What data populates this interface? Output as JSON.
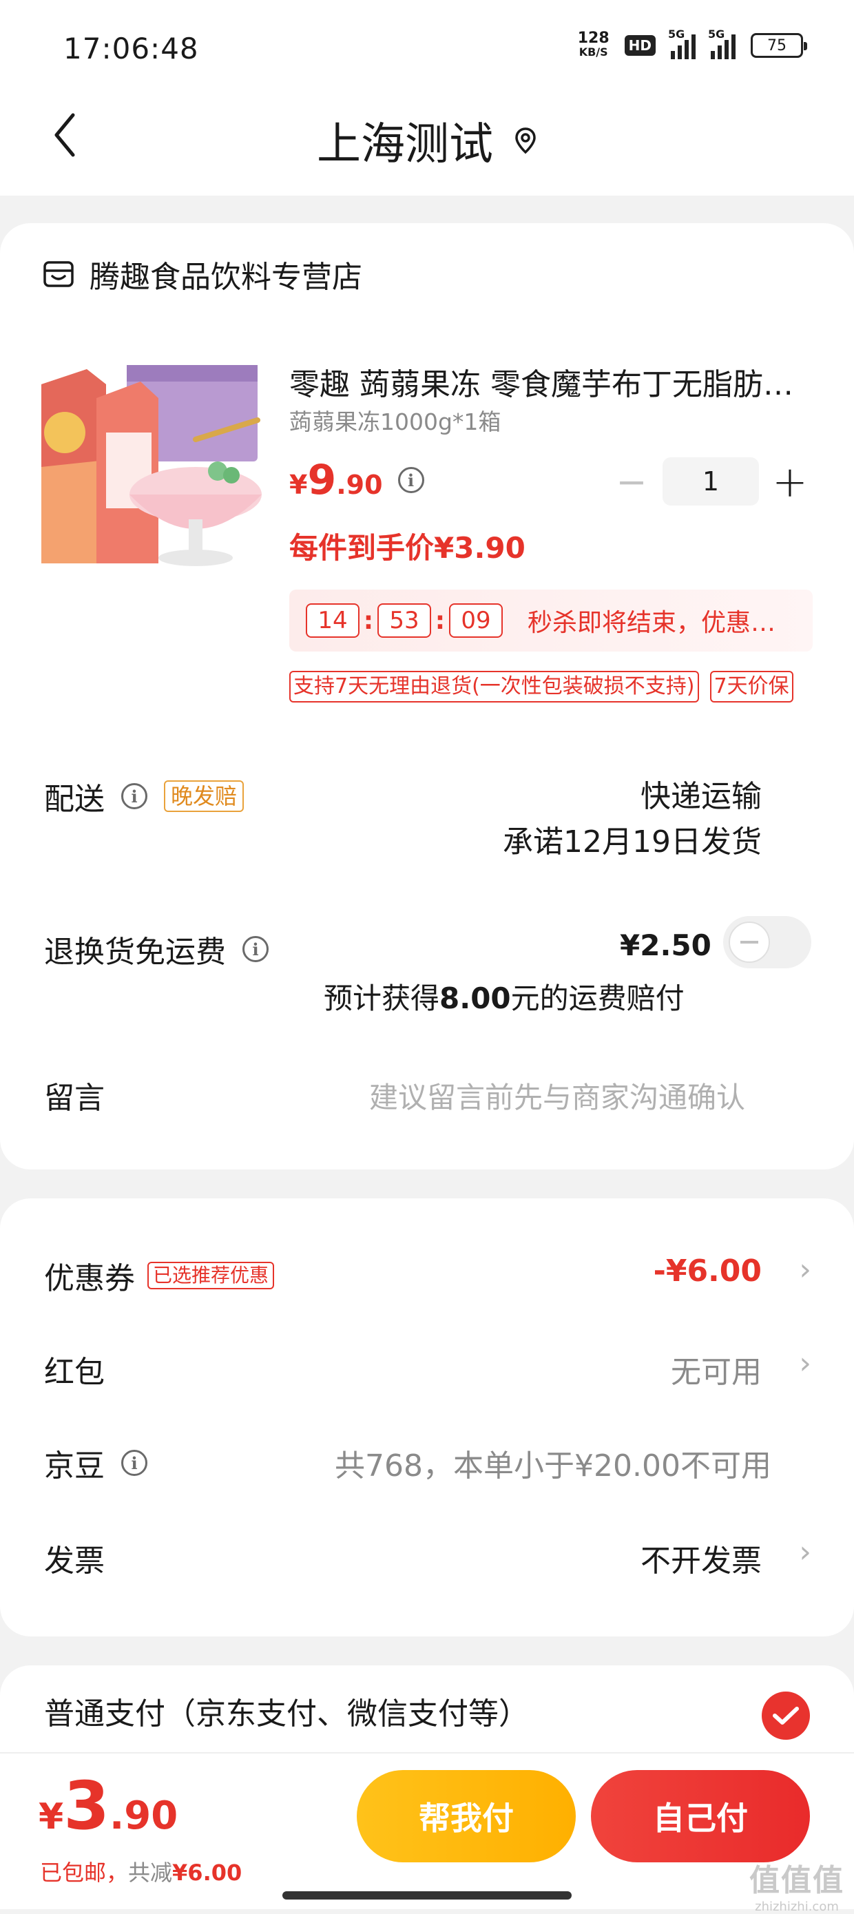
{
  "status_bar": {
    "time": "17:06:48",
    "net_speed_value": "128",
    "net_speed_unit": "KB/S",
    "hd_badge": "HD",
    "signal1_label": "5G",
    "signal2_label": "5G",
    "battery": "75"
  },
  "header": {
    "title": "上海测试"
  },
  "store": {
    "name": "腾趣食品饮料专营店"
  },
  "product": {
    "name": "零趣 蒟蒻果冻 零食魔芋布丁无脂肪…",
    "spec": "蒟蒻果冻1000g*1箱",
    "price_symbol": "¥",
    "price_int": "9",
    "price_dec": ".90",
    "quantity": "1",
    "unit_price": "每件到手价¥3.90",
    "countdown": {
      "h": "14",
      "m": "53",
      "s": "09"
    },
    "flash_text": "秒杀即将结束，优惠…",
    "tags": [
      "支持7天无理由退货(一次性包装破损不支持)",
      "7天价保"
    ]
  },
  "delivery": {
    "label": "配送",
    "tag": "晚发赔",
    "method": "快递运输",
    "promise": "承诺12月19日发货"
  },
  "return_shipping": {
    "label": "退换货免运费",
    "price": "¥2.50",
    "note_prefix": "预计获得",
    "note_amount": "8.00",
    "note_suffix": "元的运费赔付"
  },
  "message": {
    "label": "留言",
    "placeholder": "建议留言前先与商家沟通确认"
  },
  "coupon": {
    "label": "优惠券",
    "tag": "已选推荐优惠",
    "value": "-¥6.00"
  },
  "red_packet": {
    "label": "红包",
    "value": "无可用"
  },
  "jingdou": {
    "label": "京豆",
    "value": "共768，本单小于¥20.00不可用"
  },
  "invoice": {
    "label": "发票",
    "value": "不开发票"
  },
  "payment": {
    "label": "普通支付（京东支付、微信支付等）"
  },
  "bottom": {
    "total_symbol": "¥",
    "total_int": "3",
    "total_dec": ".90",
    "shipping_note": "已包邮，",
    "discount_prefix": "共减",
    "discount_value": "¥6.00",
    "help_pay": "帮我付",
    "self_pay": "自己付"
  },
  "watermark": {
    "line1": "值值值",
    "line2": "zhizhizhi.com"
  },
  "colors": {
    "accent_red": "#e6332a",
    "accent_yellow": "#ffb000",
    "tag_orange": "#e08a1e"
  }
}
